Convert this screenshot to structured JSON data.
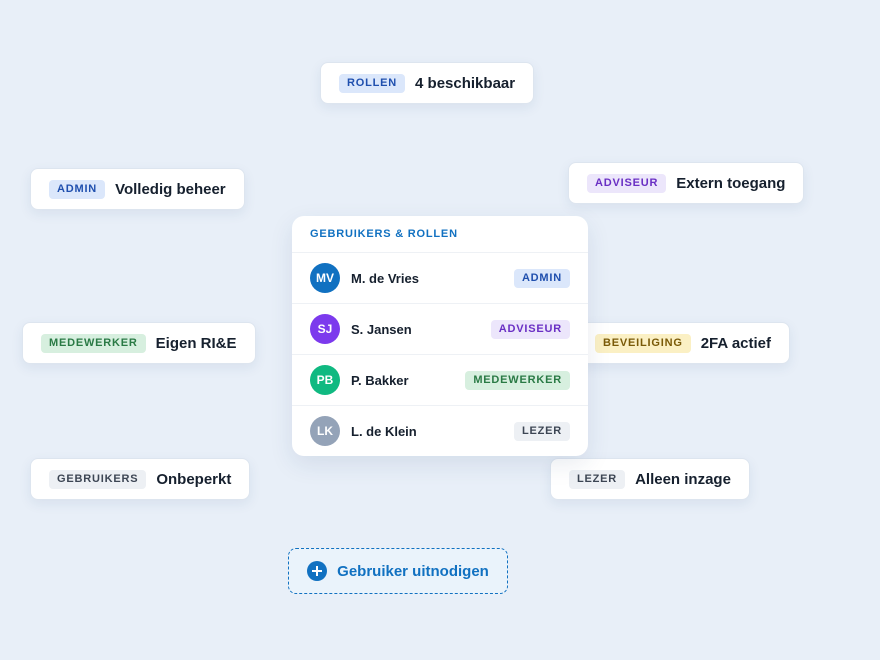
{
  "chips": {
    "rollen": {
      "tag": "ROLLEN",
      "value": "4 beschikbaar"
    },
    "admin": {
      "tag": "ADMIN",
      "value": "Volledig beheer"
    },
    "adviseur": {
      "tag": "ADVISEUR",
      "value": "Extern toegang"
    },
    "medewerker": {
      "tag": "MEDEWERKER",
      "value": "Eigen RI&E"
    },
    "beveiliging": {
      "tag": "BEVEILIGING",
      "value": "2FA actief"
    },
    "gebruikers": {
      "tag": "GEBRUIKERS",
      "value": "Onbeperkt"
    },
    "lezer": {
      "tag": "LEZER",
      "value": "Alleen inzage"
    }
  },
  "card": {
    "title": "GEBRUIKERS & ROLLEN",
    "users": [
      {
        "initials": "MV",
        "name": "M. de Vries",
        "role": "ADMIN",
        "avatar_color": "#1171c1"
      },
      {
        "initials": "SJ",
        "name": "S. Jansen",
        "role": "ADVISEUR",
        "avatar_color": "#7c3aed"
      },
      {
        "initials": "PB",
        "name": "P. Bakker",
        "role": "MEDEWERKER",
        "avatar_color": "#10b981"
      },
      {
        "initials": "LK",
        "name": "L. de Klein",
        "role": "LEZER",
        "avatar_color": "#94a3b8"
      }
    ]
  },
  "invite": {
    "label": "Gebruiker uitnodigen",
    "icon": "plus-circle-icon"
  },
  "colors": {
    "background": "#e8eff8",
    "accent": "#1171c1"
  }
}
